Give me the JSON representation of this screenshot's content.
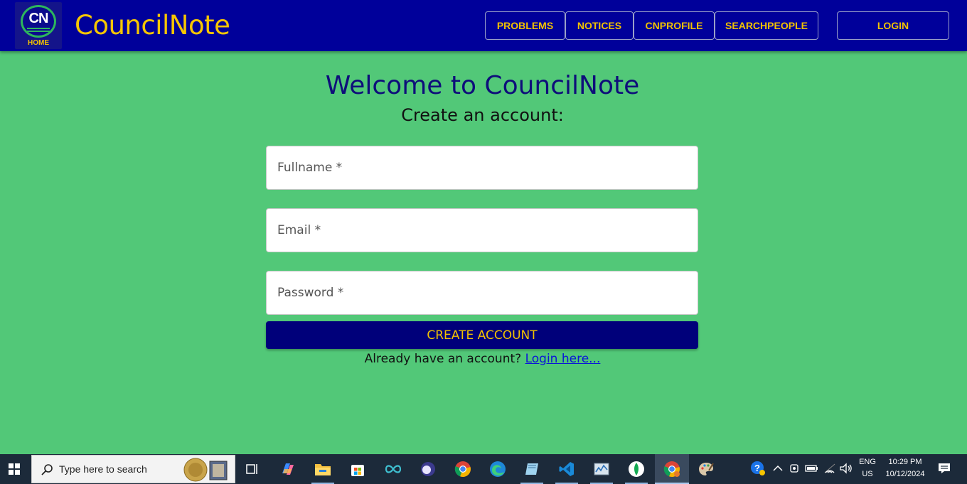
{
  "header": {
    "logo_text": "CN",
    "logo_home": "HOME",
    "brand": "CouncilNote",
    "nav": [
      "PROBLEMS",
      "NOTICES",
      "CNPROFILE",
      "SEARCHPEOPLE"
    ],
    "login": "LOGIN"
  },
  "main": {
    "welcome": "Welcome to CouncilNote",
    "subtitle": "Create an account:",
    "fields": {
      "fullname_placeholder": "Fullname *",
      "email_placeholder": "Email *",
      "password_placeholder": "Password *"
    },
    "create_button": "CREATE ACCOUNT",
    "already_text": "Already have an account?",
    "login_link": "Login here..."
  },
  "taskbar": {
    "search_placeholder": "Type here to search",
    "apps": [
      "task-view",
      "copilot",
      "file-explorer",
      "microsoft-store",
      "infinity-app",
      "dark-circle-app",
      "chrome",
      "edge",
      "notes-app",
      "vscode",
      "task-manager",
      "mongodb-compass",
      "chrome-profile",
      "paint"
    ],
    "language": "ENG",
    "region": "US",
    "time": "10:29 PM",
    "date": "10/12/2024"
  },
  "colors": {
    "background": "#52c878",
    "header": "#00009a",
    "accent": "#f2c200",
    "button": "#00007a",
    "title": "#0e0e7a"
  }
}
